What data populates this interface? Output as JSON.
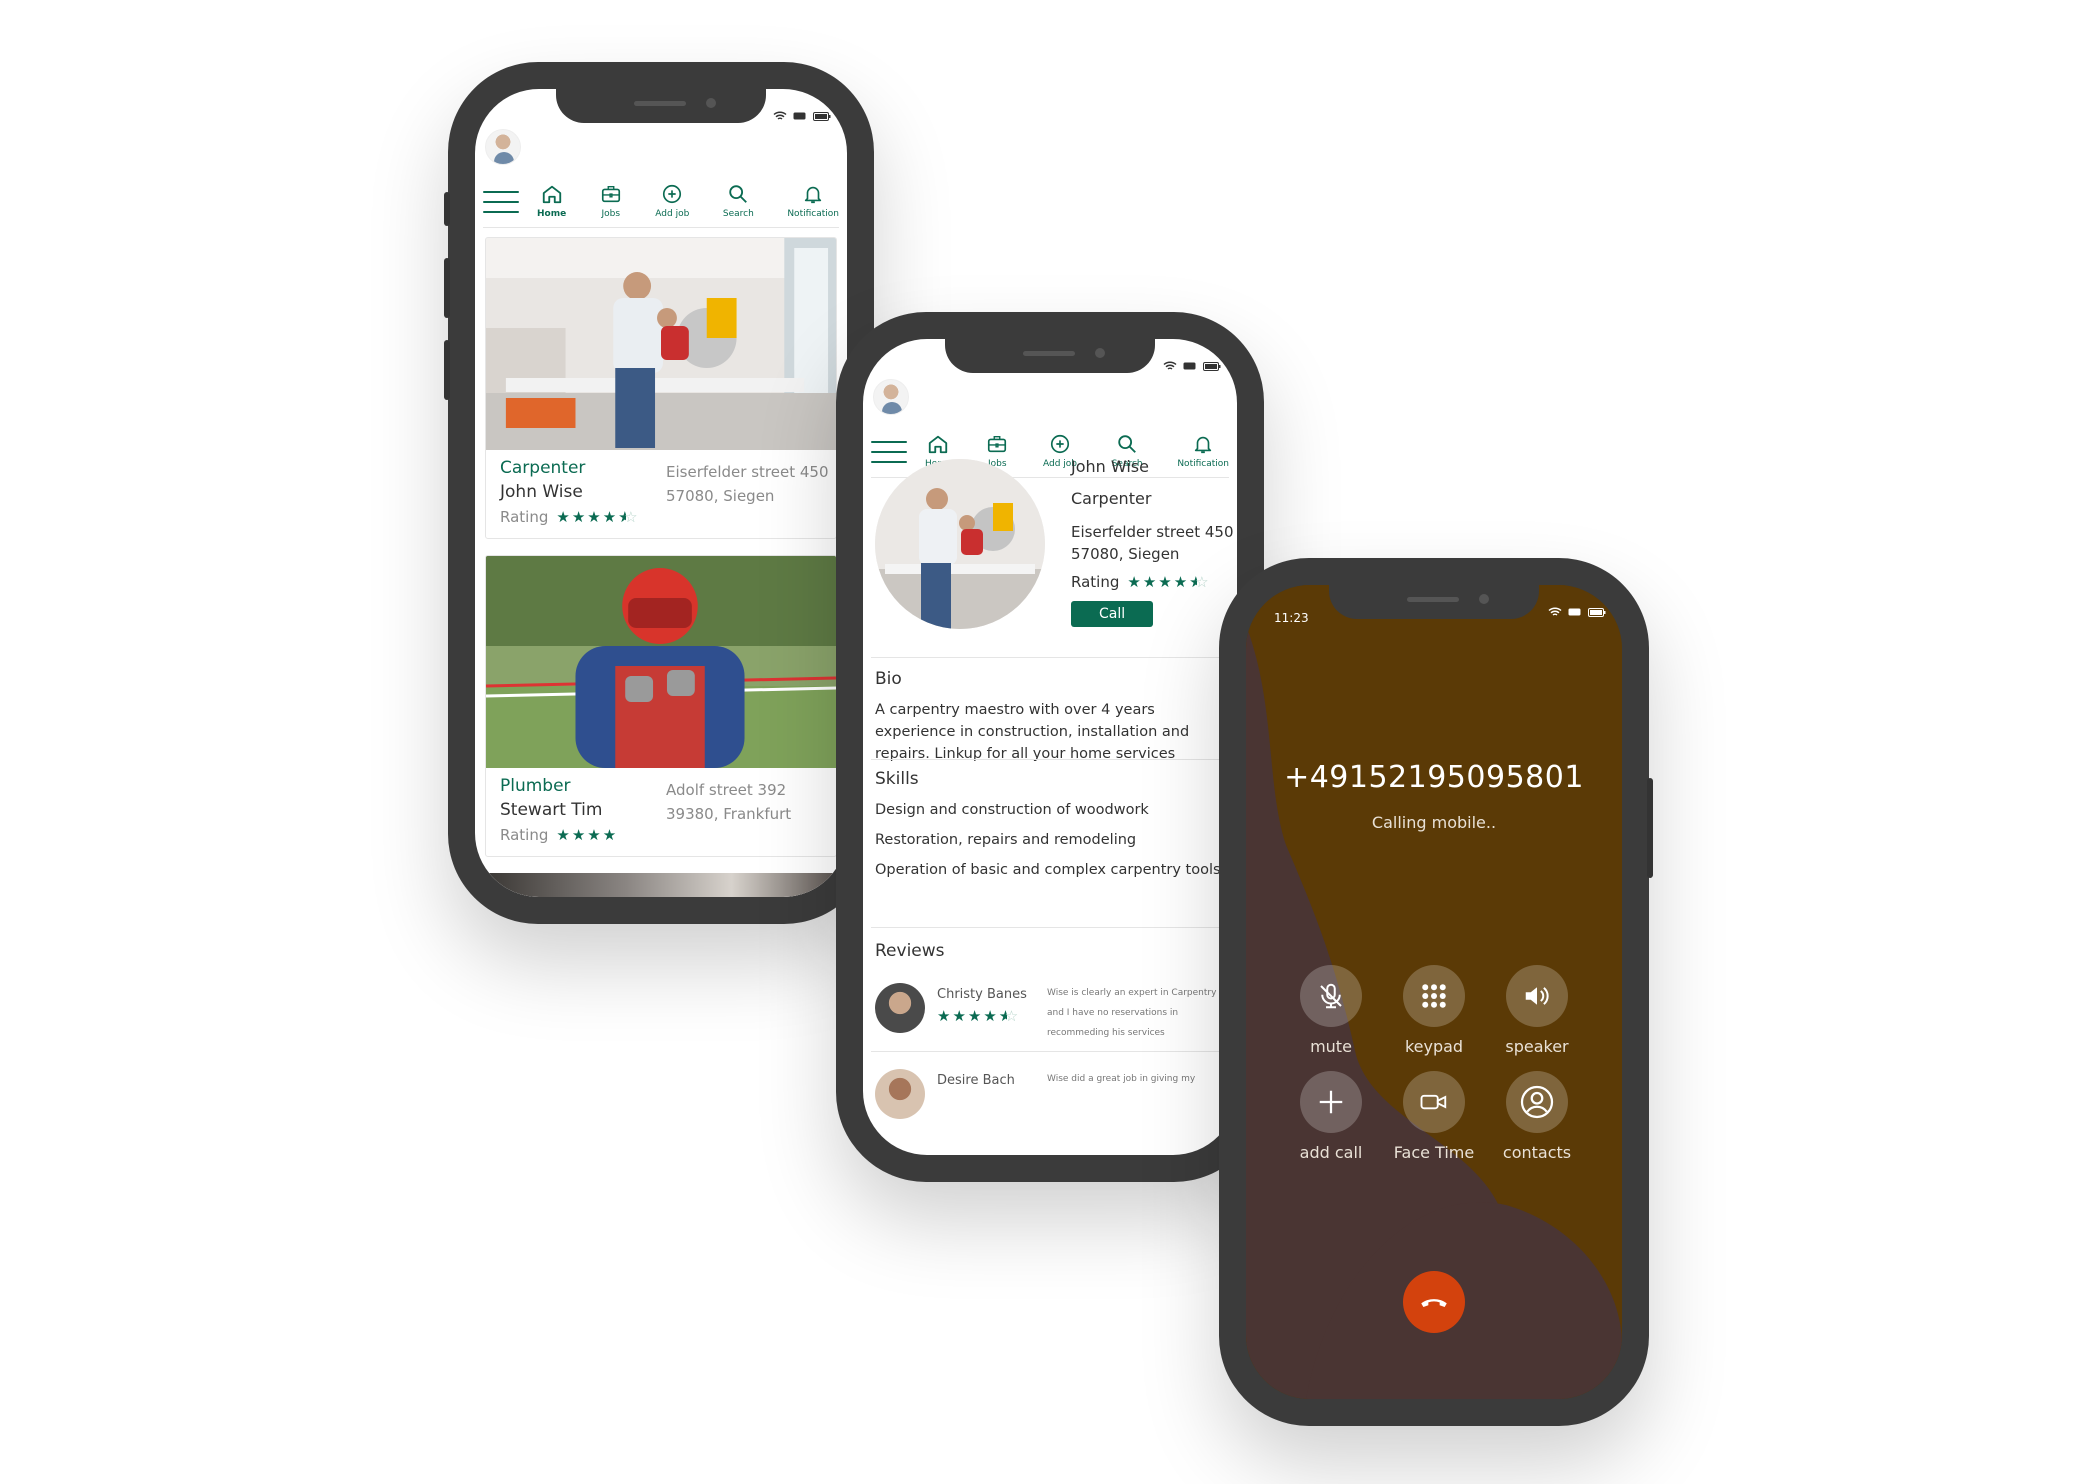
{
  "colors": {
    "brand": "#0b6b52",
    "call_bg": "#5b3a06",
    "call_wave": "#4a3533",
    "hangup": "#d3420d"
  },
  "nav": {
    "home": "Home",
    "jobs": "Jobs",
    "add_job": "Add job",
    "search": "Search",
    "notification": "Notification"
  },
  "listing": {
    "cards": [
      {
        "role": "Carpenter",
        "name": "John Wise",
        "addr1": "Eiserfelder street 450",
        "addr2": "57080, Siegen",
        "rating_label": "Rating",
        "stars": 4.5
      },
      {
        "role": "Plumber",
        "name": "Stewart Tim",
        "addr1": "Adolf street 392",
        "addr2": "39380, Frankfurt",
        "rating_label": "Rating",
        "stars": 4
      }
    ]
  },
  "profile": {
    "name": "John Wise",
    "role": "Carpenter",
    "addr1": "Eiserfelder street 450",
    "addr2": "57080, Siegen",
    "rating_label": "Rating",
    "stars": 4.5,
    "call_label": "Call",
    "bio_title": "Bio",
    "bio_text": "A carpentry maestro with over 4 years experience in construction, installation and repairs. Linkup for all your home services",
    "skills_title": "Skills",
    "skills": [
      "Design and construction of  woodwork",
      "Restoration, repairs and remodeling",
      "Operation of basic and complex carpentry tools"
    ],
    "reviews_title": "Reviews",
    "reviews": [
      {
        "name": "Christy Banes",
        "stars": 4.5,
        "text": "Wise is clearly an expert in Carpentry and I have no reservations in recommeding his services"
      },
      {
        "name": "Desire Bach",
        "text": "Wise did a great job in giving my"
      }
    ]
  },
  "call": {
    "time": "11:23",
    "number": "+49152195095801",
    "status": "Calling mobile..",
    "controls": {
      "mute": "mute",
      "keypad": "keypad",
      "speaker": "speaker",
      "add_call": "add call",
      "face_time": "Face Time",
      "contacts": "contacts"
    }
  }
}
